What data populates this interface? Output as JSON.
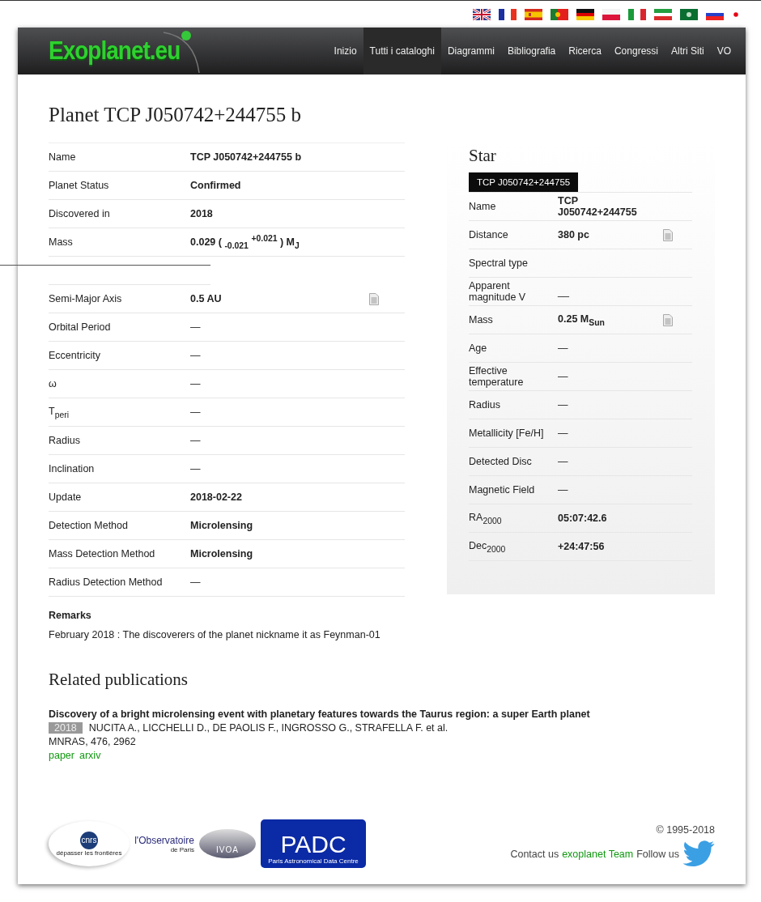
{
  "flags": [
    {
      "kind": "uk"
    },
    {
      "kind": "fr"
    },
    {
      "kind": "es"
    },
    {
      "kind": "pt"
    },
    {
      "kind": "de"
    },
    {
      "kind": "pl"
    },
    {
      "kind": "it"
    },
    {
      "kind": "ir"
    },
    {
      "kind": "ar"
    },
    {
      "kind": "ru"
    },
    {
      "kind": "jp"
    }
  ],
  "logo": "Exoplanet.eu",
  "nav": [
    {
      "label": "Inizio",
      "selected": false
    },
    {
      "label": "Tutti i cataloghi",
      "selected": true
    },
    {
      "label": "Diagrammi",
      "selected": false
    },
    {
      "label": "Bibliografia",
      "selected": false
    },
    {
      "label": "Ricerca",
      "selected": false
    },
    {
      "label": "Congressi",
      "selected": false
    },
    {
      "label": "Altri Siti",
      "selected": false
    },
    {
      "label": "VO",
      "selected": false
    }
  ],
  "title": "Planet TCP J050742+244755 b",
  "planet_rows": [
    {
      "kind": "row",
      "label": "Name",
      "value": "TCP J050742+244755 b",
      "bold": true,
      "doc": false
    },
    {
      "kind": "row",
      "label": "Planet Status",
      "value": "Confirmed",
      "bold": true,
      "doc": false
    },
    {
      "kind": "row",
      "label": "Discovered in",
      "value": "2018",
      "bold": true,
      "doc": false
    },
    {
      "kind": "row",
      "label": "Mass",
      "value": "0.029 ( $_{-0.021}$ $^{+0.021}$ ) M$_{J}$",
      "bold": true,
      "doc": false
    },
    {
      "kind": "gap"
    },
    {
      "kind": "row",
      "label": "Semi-Major Axis",
      "value": "0.5 AU",
      "bold": true,
      "doc": true
    },
    {
      "kind": "row",
      "label": "Orbital Period",
      "value": "—",
      "bold": false,
      "doc": false
    },
    {
      "kind": "row",
      "label": "Eccentricity",
      "value": "—",
      "bold": false,
      "doc": false
    },
    {
      "kind": "row",
      "label": "ω",
      "value": "—",
      "bold": false,
      "doc": false
    },
    {
      "kind": "row",
      "label": "T$_{peri}$",
      "value": "—",
      "bold": false,
      "doc": false
    },
    {
      "kind": "row",
      "label": "Radius",
      "value": "—",
      "bold": false,
      "doc": false
    },
    {
      "kind": "row",
      "label": "Inclination",
      "value": "—",
      "bold": false,
      "doc": false
    },
    {
      "kind": "row",
      "label": "Update",
      "value": "2018-02-22",
      "bold": true,
      "doc": false
    },
    {
      "kind": "row",
      "label": "Detection Method",
      "value": "Microlensing",
      "bold": true,
      "doc": false
    },
    {
      "kind": "row",
      "label": "Mass Detection Method",
      "value": "Microlensing",
      "bold": true,
      "doc": false
    },
    {
      "kind": "row",
      "label": "Radius Detection Method",
      "value": "—",
      "bold": false,
      "doc": false
    }
  ],
  "remarks": {
    "heading": "Remarks",
    "text": "February 2018 : The discoverers of the planet nickname it as Feynman-01"
  },
  "star": {
    "heading": "Star",
    "tabs": [
      {
        "label": "TCP J050742+244755",
        "selected": true
      }
    ],
    "rows": [
      {
        "label": "Name",
        "value": "TCP J050742+244755",
        "bold": true,
        "doc": false
      },
      {
        "label": "Distance",
        "value": "380 pc",
        "bold": true,
        "doc": true
      },
      {
        "label": "Spectral type",
        "doc": false
      },
      {
        "label": "Apparent magnitude V",
        "value": "__",
        "bold": false,
        "doc": false
      },
      {
        "label": "Mass",
        "value": "0.25 M$_{Sun}$",
        "bold": true,
        "doc": true
      },
      {
        "label": "Age",
        "value": "—",
        "bold": false,
        "doc": false
      },
      {
        "label": "Effective temperature",
        "value": "—",
        "bold": false,
        "doc": false
      },
      {
        "label": "Radius",
        "value": "—",
        "bold": false,
        "doc": false
      },
      {
        "label": "Metallicity [Fe/H]",
        "value": "—",
        "bold": false,
        "doc": false
      },
      {
        "label": "Detected Disc",
        "value": "—",
        "bold": false,
        "doc": false
      },
      {
        "label": "Magnetic Field",
        "value": "—",
        "bold": false,
        "doc": false
      },
      {
        "label": "RA$_{2000}$",
        "value": "05:07:42.6",
        "bold": true,
        "doc": false
      },
      {
        "label": "Dec$_{2000}$",
        "value": "+24:47:56",
        "bold": true,
        "doc": false
      }
    ]
  },
  "publications": {
    "heading": "Related publications",
    "items": [
      {
        "title": "Discovery of a bright microlensing event with planetary features towards the Taurus region: a super Earth planet",
        "year": "2018",
        "authors": "NUCITA A., LICCHELLI D., DE PAOLIS F., INGROSSO G., STRAFELLA F. et al.",
        "journal": "MNRAS, 476, 2962",
        "links": [
          "paper",
          "arxiv"
        ]
      }
    ]
  },
  "footer": {
    "logos": [
      {
        "kind": "cnrs",
        "texts": [
          "cnrs",
          "dépasser les frontières"
        ]
      },
      {
        "kind": "obs",
        "texts": [
          "l'Observatoire",
          "de Paris"
        ]
      },
      {
        "kind": "ivoa",
        "texts": [
          "IVOA"
        ]
      },
      {
        "kind": "padc",
        "texts": [
          "PADC",
          "Paris Astronomical Data Centre"
        ]
      }
    ],
    "copyright": "© 1995-2018",
    "contact": "Contact us",
    "team": "exoplanet Team",
    "follow": "Follow us"
  }
}
